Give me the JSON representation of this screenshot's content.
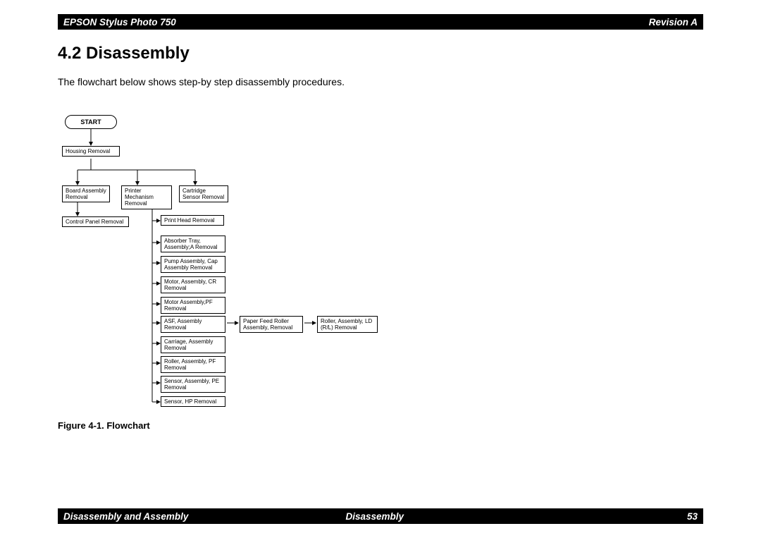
{
  "header": {
    "left": "EPSON Stylus Photo 750",
    "right": "Revision A"
  },
  "section": {
    "title": "4.2  Disassembly",
    "intro": "The flowchart below shows step-by step disassembly procedures.",
    "figure_caption": "Figure 4-1.  Flowchart"
  },
  "footer": {
    "left": "Disassembly and Assembly",
    "center": "Disassembly",
    "page": "53"
  },
  "flowchart": {
    "start": "START",
    "housing": "Housing Removal",
    "row1": {
      "board": "Board Assembly Removal",
      "mech": "Printer Mechanism Removal",
      "cart": "Cartridge Sensor Removal"
    },
    "control_panel": "Control Panel Removal",
    "mech_children": [
      "Print Head Removal",
      "Absorber Tray, Assembly;A Removal",
      "Pump Assembly, Cap Assembly Removal",
      "Motor, Assembly, CR Removal",
      "Motor Assembly,PF Removal",
      "ASF, Assembly Removal",
      "Carriage, Assembly Removal",
      "Roller, Assembly, PF Removal",
      "Sensor, Assembly, PE Removal",
      "Sensor, HP Removal"
    ],
    "asf_children": {
      "paper_feed": "Paper Feed Roller Assembly, Removal",
      "roller_ld": "Roller, Assembly, LD (R/L) Removal"
    }
  }
}
